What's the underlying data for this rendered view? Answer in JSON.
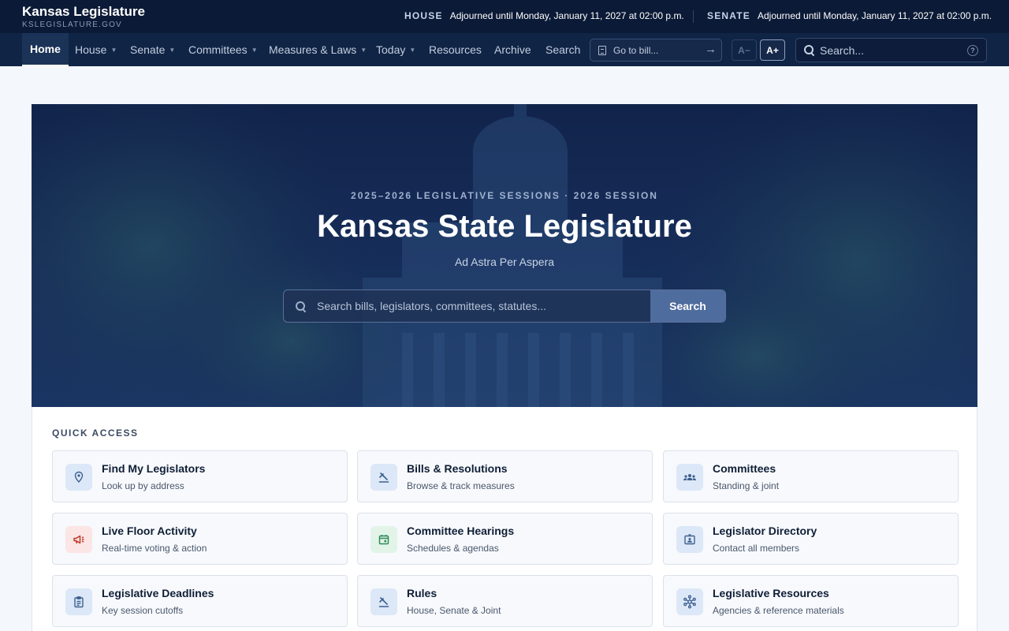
{
  "site": {
    "title": "Kansas Legislature",
    "domain": "KSLEGISLATURE.GOV"
  },
  "status": {
    "house_label": "HOUSE",
    "house_text": "Adjourned until Monday, January 11, 2027 at 02:00 p.m.",
    "senate_label": "SENATE",
    "senate_text": "Adjourned until Monday, January 11, 2027 at 02:00 p.m."
  },
  "nav": {
    "items": [
      {
        "label": "Home",
        "active": true
      },
      {
        "label": "House",
        "dropdown": true
      },
      {
        "label": "Senate",
        "dropdown": true
      },
      {
        "label": "Committees",
        "dropdown": true
      },
      {
        "label": "Measures & Laws",
        "dropdown": true
      },
      {
        "label": "Today",
        "dropdown": true
      },
      {
        "label": "Resources"
      },
      {
        "label": "Archive"
      },
      {
        "label": "Search"
      }
    ],
    "goto_placeholder": "Go to bill...",
    "font_decrease": "A−",
    "font_increase": "A+",
    "search_placeholder": "Search...",
    "help_glyph": "?"
  },
  "hero": {
    "kicker": "2025–2026 LEGISLATIVE SESSIONS · 2026 SESSION",
    "title": "Kansas State Legislature",
    "motto": "Ad Astra Per Aspera",
    "search_placeholder": "Search bills, legislators, committees, statutes...",
    "search_button": "Search"
  },
  "quick_access": {
    "heading": "QUICK ACCESS",
    "cards": [
      {
        "title": "Find My Legislators",
        "subtitle": "Look up by address",
        "icon": "map-pin-icon"
      },
      {
        "title": "Bills & Resolutions",
        "subtitle": "Browse & track measures",
        "icon": "gavel-icon"
      },
      {
        "title": "Committees",
        "subtitle": "Standing & joint",
        "icon": "group-icon"
      },
      {
        "title": "Live Floor Activity",
        "subtitle": "Real-time voting & action",
        "icon": "megaphone-icon"
      },
      {
        "title": "Committee Hearings",
        "subtitle": "Schedules & agendas",
        "icon": "calendar-icon"
      },
      {
        "title": "Legislator Directory",
        "subtitle": "Contact all members",
        "icon": "id-card-icon"
      },
      {
        "title": "Legislative Deadlines",
        "subtitle": "Key session cutoffs",
        "icon": "clipboard-icon"
      },
      {
        "title": "Rules",
        "subtitle": "House, Senate & Joint",
        "icon": "gavel-icon"
      },
      {
        "title": "Legislative Resources",
        "subtitle": "Agencies & reference materials",
        "icon": "network-icon"
      }
    ]
  },
  "colors": {
    "topbar": "#0b1a36",
    "navbar": "#102445",
    "accent": "#4f6c9e",
    "icon_blue": "#3e5f8f",
    "icon_red": "#c0392b",
    "icon_green": "#2e8b57"
  }
}
